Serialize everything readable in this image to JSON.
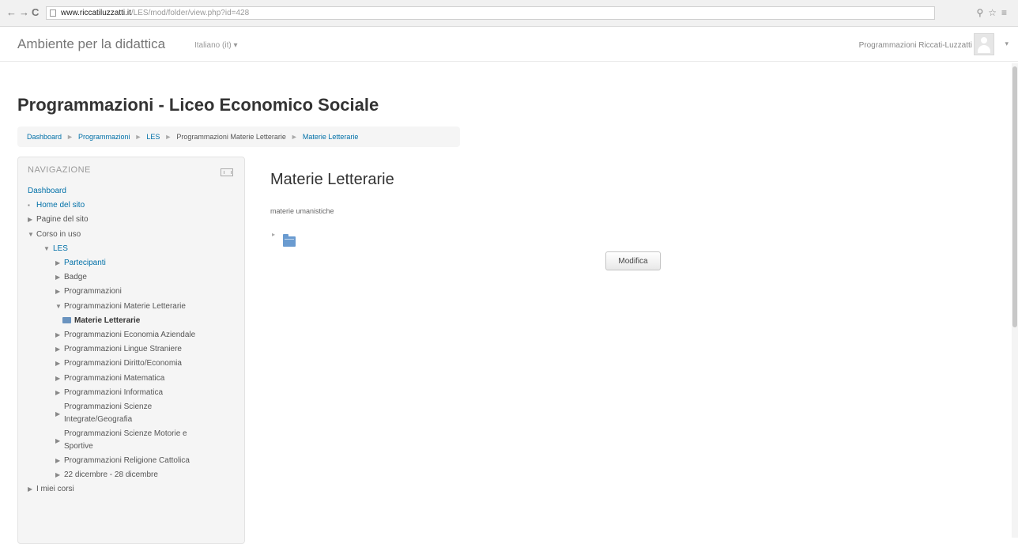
{
  "browser": {
    "url_host": "www.riccatiluzzatti.it",
    "url_path": "/LES/mod/folder/view.php?id=428",
    "back_icon": "back-arrow-icon",
    "forward_icon": "forward-arrow-icon",
    "reload_icon": "reload-icon"
  },
  "navbar": {
    "brand": "Ambiente per la didattica",
    "language": "Italiano (it) ▾",
    "user_name": "Programmazioni Riccati-Luzzatti",
    "user_caret": "▾"
  },
  "page": {
    "heading": "Programmazioni - Liceo Economico Sociale"
  },
  "breadcrumb": [
    {
      "label": "Dashboard"
    },
    {
      "label": "Programmazioni"
    },
    {
      "label": "LES"
    },
    {
      "label": "Programmazioni Materie Letterarie"
    },
    {
      "label": "Materie Letterarie"
    }
  ],
  "breadcrumb_sep": "►",
  "navigation": {
    "title": "NAVIGAZIONE",
    "items": [
      {
        "label": "Dashboard",
        "marker": ""
      },
      {
        "label": "Home del sito",
        "marker": "▪"
      },
      {
        "label": "Pagine del sito",
        "marker": "▶"
      },
      {
        "label": "Corso in uso",
        "marker": "▼"
      },
      {
        "label": "LES",
        "marker": "▼"
      },
      {
        "label": "Partecipanti",
        "marker": "▶"
      },
      {
        "label": "Badge",
        "marker": "▶"
      },
      {
        "label": "Programmazioni",
        "marker": "▶"
      },
      {
        "label": "Programmazioni Materie Letterarie",
        "marker": "▼"
      },
      {
        "label": "Materie Letterarie",
        "marker": ""
      },
      {
        "label": "Programmazioni Economia Aziendale",
        "marker": "▶"
      },
      {
        "label": "Programmazioni Lingue Straniere",
        "marker": "▶"
      },
      {
        "label": "Programmazioni Diritto/Economia",
        "marker": "▶"
      },
      {
        "label": "Programmazioni Matematica",
        "marker": "▶"
      },
      {
        "label": "Programmazioni Informatica",
        "marker": "▶"
      },
      {
        "label": "Programmazioni Scienze Integrate/Geografia",
        "marker": "▶"
      },
      {
        "label": "Programmazioni Scienze Motorie e Sportive",
        "marker": "▶"
      },
      {
        "label": "Programmazioni Religione Cattolica",
        "marker": "▶"
      },
      {
        "label": "22 dicembre - 28 dicembre",
        "marker": "▶"
      },
      {
        "label": "I miei corsi",
        "marker": "▶"
      }
    ]
  },
  "main": {
    "title": "Materie Letterarie",
    "intro": "materie umanistiche",
    "folder_icon": "folder-icon",
    "edit_button": "Modifica"
  }
}
